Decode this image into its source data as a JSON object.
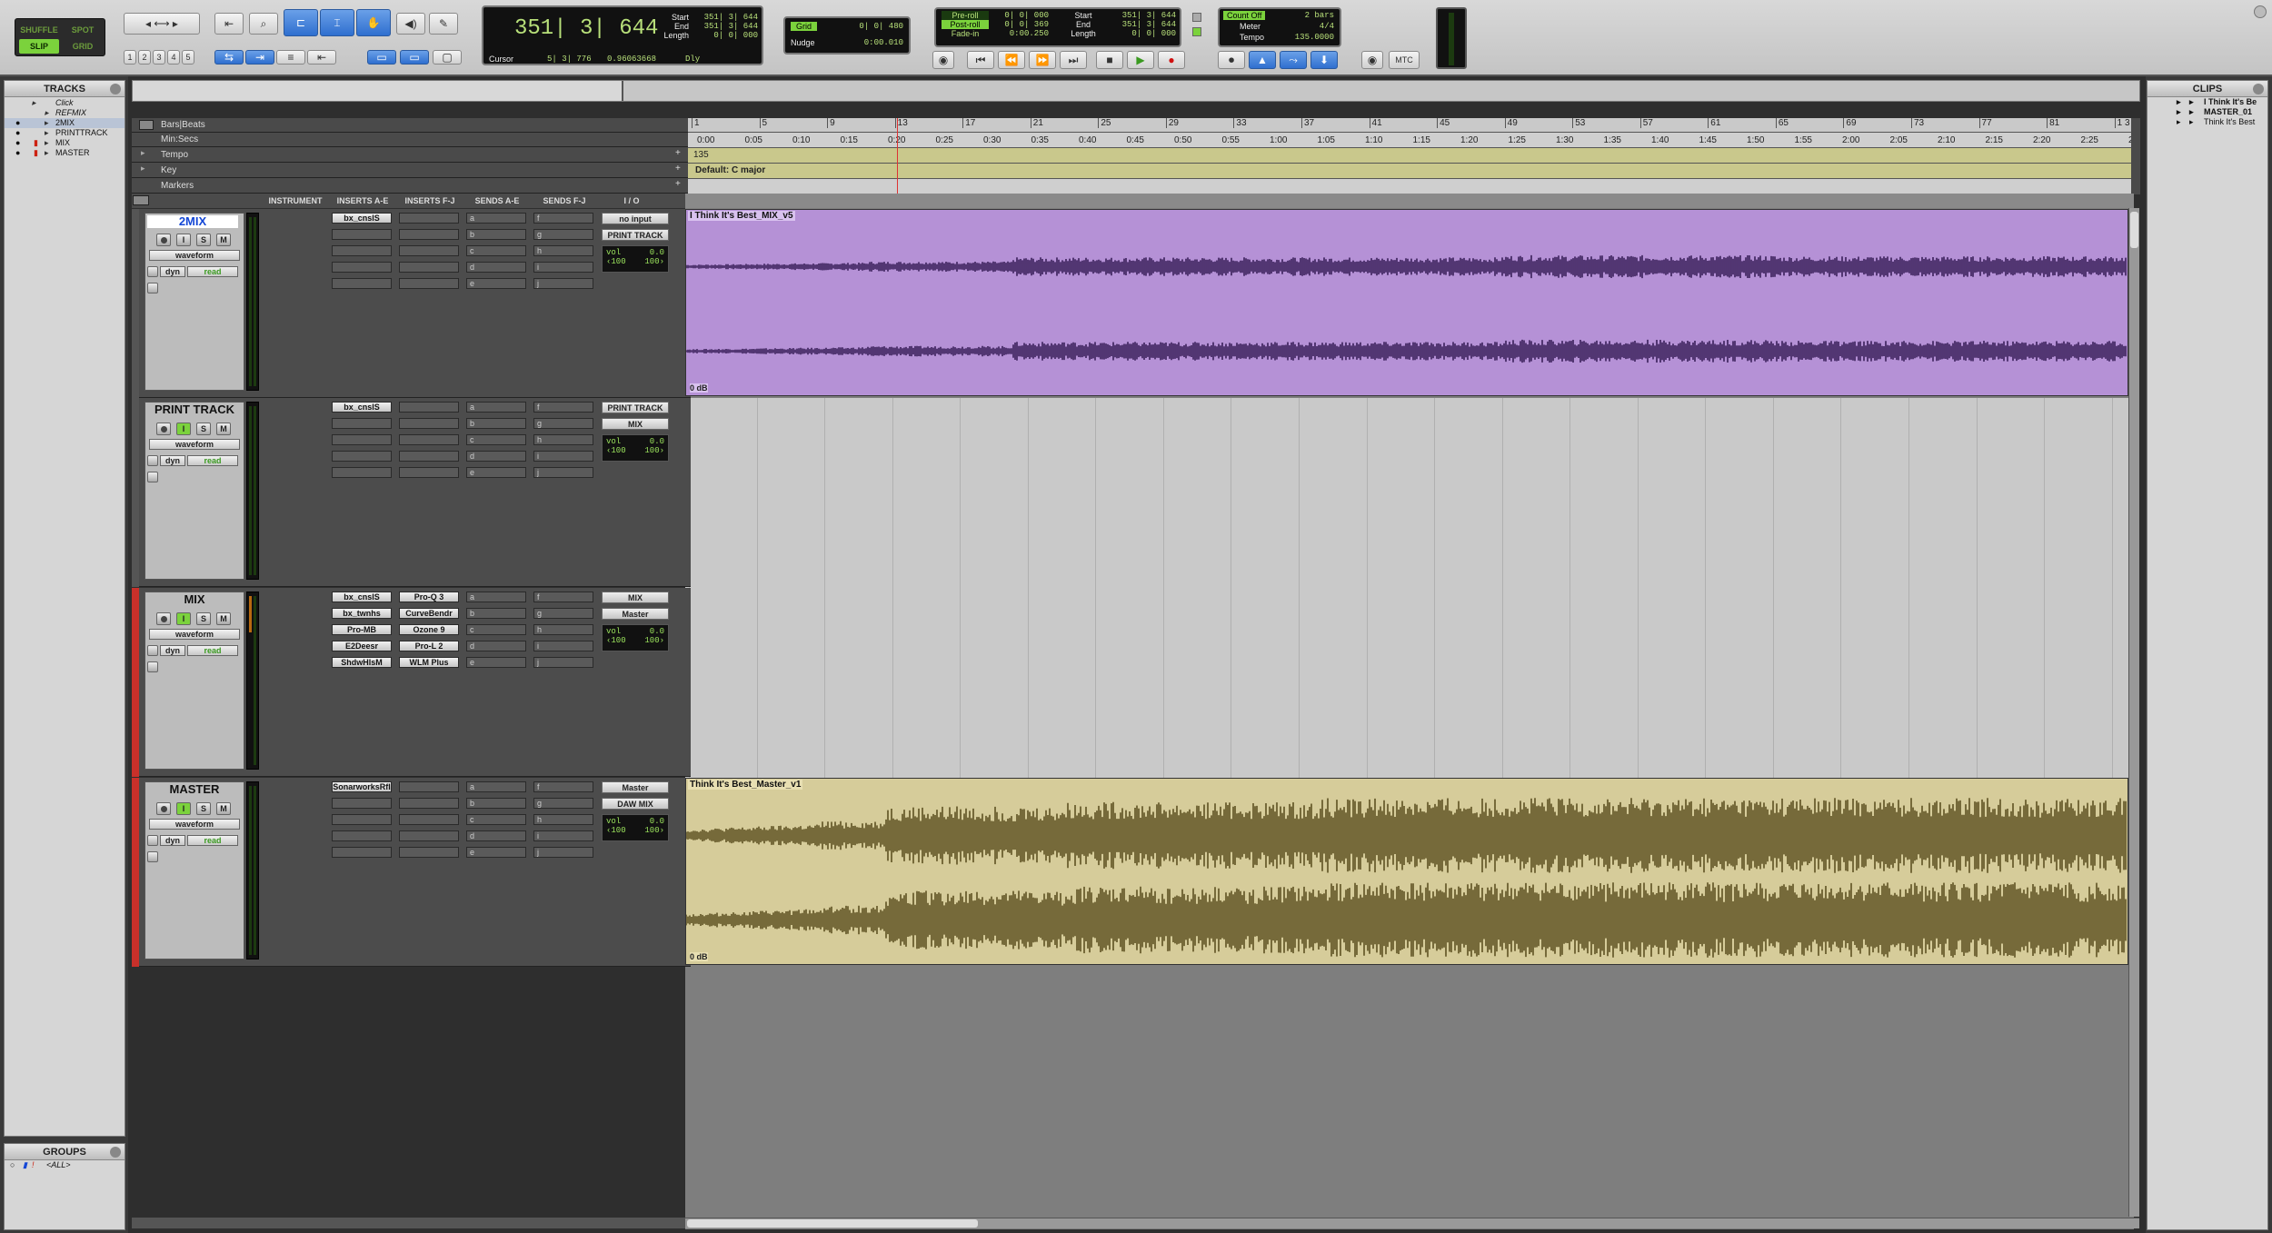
{
  "toolbar": {
    "modes": [
      "SHUFFLE",
      "SPOT",
      "SLIP",
      "GRID"
    ],
    "zoom_presets": [
      "1",
      "2",
      "3",
      "4",
      "5"
    ],
    "counter_main": "351| 3| 644",
    "sel_labels": [
      "Start",
      "End",
      "Length"
    ],
    "sel_values": [
      "351| 3| 644",
      "351| 3| 644",
      "0| 0| 000"
    ],
    "cursor_label": "Cursor",
    "cursor_value": "5| 3| 776",
    "cursor_sample": "0.96063668",
    "dly_label": "Dly",
    "grid_label": "Grid",
    "grid_value": "0| 0| 480",
    "nudge_label": "Nudge",
    "nudge_value": "0:00.010",
    "roll_labels": [
      "Pre-roll",
      "Post-roll",
      "Fade-in"
    ],
    "roll_values": [
      "0| 0| 000",
      "0| 0| 369",
      "0:00.250"
    ],
    "t_labels": [
      "Start",
      "End",
      "Length"
    ],
    "t_values": [
      "351| 3| 644",
      "351| 3| 644",
      "0| 0| 000"
    ],
    "count_off": "Count Off",
    "count_bars": "2 bars",
    "meter_label": "Meter",
    "meter_value": "4/4",
    "tempo_label": "Tempo",
    "tempo_value": "135.0000",
    "mtc": "MTC"
  },
  "tracks_panel": {
    "title": "TRACKS",
    "items": [
      "Click",
      "REFMIX",
      "2MIX",
      "PRINTTRACK",
      "MIX",
      "MASTER"
    ]
  },
  "groups_panel": {
    "title": "GROUPS",
    "items": [
      "<ALL>"
    ]
  },
  "clips_panel": {
    "title": "CLIPS",
    "items": [
      "I Think It's Be",
      "MASTER_01",
      "Think It's Best"
    ]
  },
  "rulers": {
    "rows": [
      "Bars|Beats",
      "Min:Secs",
      "Tempo",
      "Key",
      "Markers"
    ],
    "bars": [
      "1",
      "5",
      "9",
      "13",
      "17",
      "21",
      "25",
      "29",
      "33",
      "37",
      "41",
      "45",
      "49",
      "53",
      "57",
      "61",
      "65",
      "69",
      "73",
      "77",
      "81",
      "1 3"
    ],
    "mins": [
      "0:00",
      "0:05",
      "0:10",
      "0:15",
      "0:20",
      "0:25",
      "0:30",
      "0:35",
      "0:40",
      "0:45",
      "0:50",
      "0:55",
      "1:00",
      "1:05",
      "1:10",
      "1:15",
      "1:20",
      "1:25",
      "1:30",
      "1:35",
      "1:40",
      "1:45",
      "1:50",
      "1:55",
      "2:00",
      "2:05",
      "2:10",
      "2:15",
      "2:20",
      "2:25",
      "2"
    ],
    "tempo_marker": "135",
    "key_marker": "Default: C major"
  },
  "columns": [
    "INSTRUMENT",
    "INSERTS A-E",
    "INSERTS F-J",
    "SENDS A-E",
    "SENDS F-J",
    "I / O"
  ],
  "tracks": [
    {
      "name": "2MIX",
      "view": "waveform",
      "auto_mode": "read",
      "dyn": "dyn",
      "inserts_ae": [
        "bx_cnslS",
        "",
        "",
        "",
        ""
      ],
      "inserts_fj": [
        "",
        "",
        "",
        "",
        ""
      ],
      "sends_ae": [
        "a",
        "b",
        "c",
        "d",
        "e"
      ],
      "sends_fj": [
        "f",
        "g",
        "h",
        "i",
        "j"
      ],
      "io_in": "no input",
      "io_out": "PRINT TRACK",
      "vol_label": "vol",
      "vol": "0.0",
      "pan_l": "‹100",
      "pan_r": "100›",
      "clip": "I Think It's Best_MIX_v5",
      "clip_gain": "0 dB"
    },
    {
      "name": "PRINT TRACK",
      "view": "waveform",
      "auto_mode": "read",
      "dyn": "dyn",
      "inserts_ae": [
        "bx_cnslS",
        "",
        "",
        "",
        ""
      ],
      "inserts_fj": [
        "",
        "",
        "",
        "",
        ""
      ],
      "sends_ae": [
        "a",
        "b",
        "c",
        "d",
        "e"
      ],
      "sends_fj": [
        "f",
        "g",
        "h",
        "i",
        "j"
      ],
      "io_in": "PRINT TRACK",
      "io_out": "MIX",
      "vol_label": "vol",
      "vol": "0.0",
      "pan_l": "‹100",
      "pan_r": "100›",
      "clip": "",
      "clip_gain": ""
    },
    {
      "name": "MIX",
      "view": "waveform",
      "auto_mode": "read",
      "dyn": "dyn",
      "inserts_ae": [
        "bx_cnslS",
        "bx_twnhs",
        "Pro-MB",
        "E2Deesr",
        "ShdwHlsM"
      ],
      "inserts_fj": [
        "Pro-Q 3",
        "CurveBendr",
        "Ozone 9",
        "Pro-L 2",
        "WLM Plus"
      ],
      "sends_ae": [
        "a",
        "b",
        "c",
        "d",
        "e"
      ],
      "sends_fj": [
        "f",
        "g",
        "h",
        "i",
        "j"
      ],
      "io_in": "MIX",
      "io_out": "Master",
      "vol_label": "vol",
      "vol": "0.0",
      "pan_l": "‹100",
      "pan_r": "100›",
      "clip": "",
      "clip_gain": ""
    },
    {
      "name": "MASTER",
      "view": "waveform",
      "auto_mode": "read",
      "dyn": "dyn",
      "inserts_ae": [
        "SonarworksRfI",
        "",
        "",
        "",
        ""
      ],
      "inserts_fj": [
        "",
        "",
        "",
        "",
        ""
      ],
      "sends_ae": [
        "a",
        "b",
        "c",
        "d",
        "e"
      ],
      "sends_fj": [
        "f",
        "g",
        "h",
        "i",
        "j"
      ],
      "io_in": "Master",
      "io_out": "DAW MIX",
      "vol_label": "vol",
      "vol": "0.0",
      "pan_l": "‹100",
      "pan_r": "100›",
      "clip": "Think It's Best_Master_v1",
      "clip_gain": "0 dB"
    }
  ],
  "colors": {
    "mix_clip": "#b591d6",
    "mix_wave": "#3a1f5a",
    "master_clip": "#d6cc9a",
    "master_wave": "#5e5122",
    "counter_green": "#b8e07a",
    "ruler_tempo": "#c9c88c"
  },
  "icons": [
    "trim-tool-icon",
    "zoom-tool-icon",
    "selector-tool-icon",
    "grabber-tool-icon",
    "scrub-tool-icon",
    "pencil-tool-icon",
    "rewind-icon",
    "fast-forward-icon",
    "stop-icon",
    "play-icon",
    "record-icon",
    "loop-icon"
  ]
}
